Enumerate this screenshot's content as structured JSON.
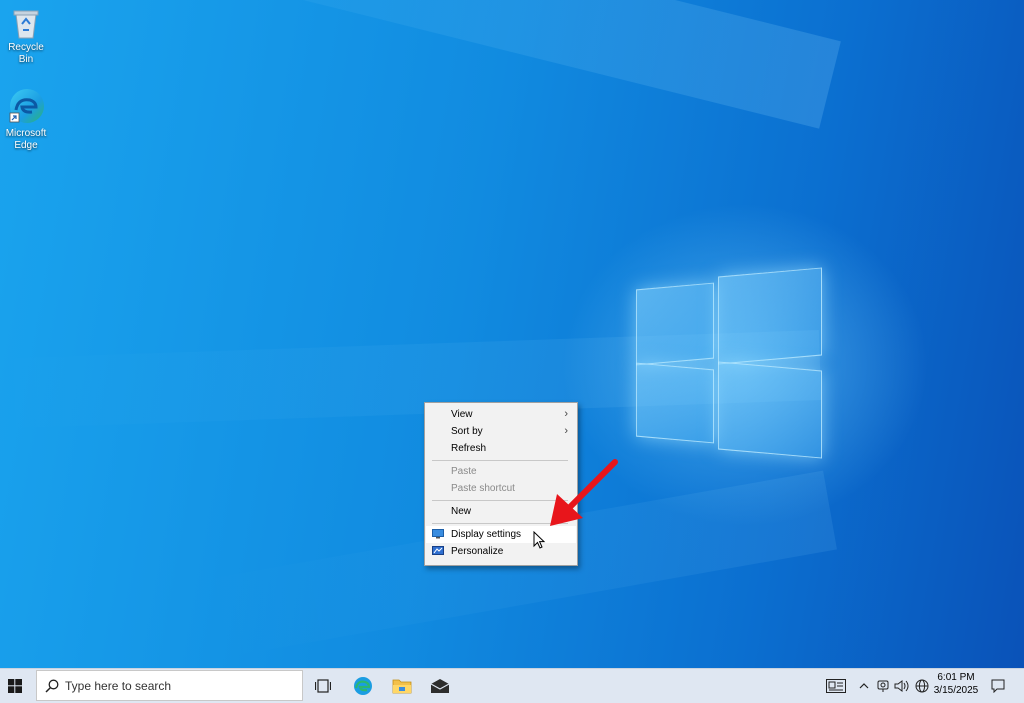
{
  "desktop": {
    "icons": [
      {
        "label": "Recycle Bin",
        "icon": "recycle-bin-icon"
      },
      {
        "label": "Microsoft Edge",
        "icon": "edge-icon"
      }
    ]
  },
  "context_menu": {
    "items": [
      {
        "label": "View",
        "has_submenu": true,
        "enabled": true
      },
      {
        "label": "Sort by",
        "has_submenu": true,
        "enabled": true
      },
      {
        "label": "Refresh",
        "enabled": true
      },
      {
        "label": "Paste",
        "enabled": false
      },
      {
        "label": "Paste shortcut",
        "enabled": false
      },
      {
        "label": "New",
        "enabled": true
      },
      {
        "label": "Display settings",
        "enabled": true,
        "icon": "display-icon",
        "highlighted": true
      },
      {
        "label": "Personalize",
        "enabled": true,
        "icon": "personalize-icon"
      }
    ],
    "submenu_glyph": "›"
  },
  "taskbar": {
    "search_placeholder": "Type here to search",
    "pinned": [
      "task-view-icon",
      "edge-icon",
      "file-explorer-icon",
      "mail-icon"
    ],
    "tray_icons": [
      "news-widget-icon",
      "chevron-up-icon",
      "meet-now-icon",
      "volume-icon",
      "network-icon"
    ],
    "clock": {
      "time": "6:01 PM",
      "date": "3/15/2025"
    },
    "notification_icon": "action-center-icon"
  },
  "colors": {
    "annotation_arrow": "#e8151b",
    "accent": "#0078d7"
  }
}
